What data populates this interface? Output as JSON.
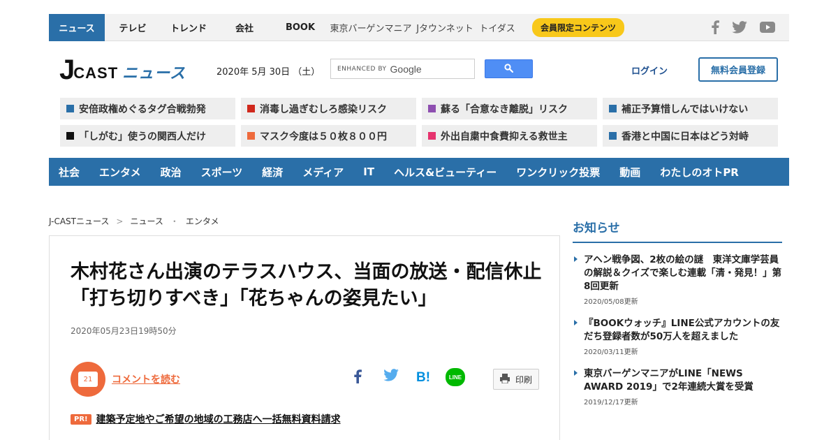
{
  "topnav": {
    "items": [
      {
        "label": "ニュース",
        "active": true
      },
      {
        "label": "テレビ"
      },
      {
        "label": "トレンド"
      },
      {
        "label": "会社"
      },
      {
        "label": "BOOK"
      },
      {
        "label": "東京バーゲンマニア"
      },
      {
        "label": "Jタウンネット"
      },
      {
        "label": "トイダス"
      }
    ],
    "member_label": "会員限定コンテンツ",
    "social": [
      "facebook-icon",
      "twitter-icon",
      "youtube-icon"
    ]
  },
  "header": {
    "logo_j": "J",
    "logo_cast": "CAST",
    "logo_news": "ニュース",
    "date": "2020年 5月 30日 （土）",
    "search_enhanced": "ENHANCED BY",
    "search_google": "Google",
    "login_label": "ログイン",
    "register_label": "無料会員登録"
  },
  "tags": [
    {
      "label": "安倍政権めぐるタグ合戦勃発",
      "color": "#2a6fa8"
    },
    {
      "label": "消毒し過ぎむしろ感染リスク",
      "color": "#d0281c"
    },
    {
      "label": "蘇る「合意なき離脱」リスク",
      "color": "#8e4fb0"
    },
    {
      "label": "補正予算惜しんではいけない",
      "color": "#2a6fa8"
    },
    {
      "label": "「しがむ」使うの関西人だけ",
      "color": "#111111"
    },
    {
      "label": "マスク今度は５０枚８００円",
      "color": "#ee6a3c"
    },
    {
      "label": "外出自粛中食費抑える救世主",
      "color": "#e6336e"
    },
    {
      "label": "香港と中国に日本はどう対峙",
      "color": "#2a6fa8"
    }
  ],
  "categories": [
    "社会",
    "エンタメ",
    "政治",
    "スポーツ",
    "経済",
    "メディア",
    "IT",
    "ヘルス&ビューティー",
    "ワンクリック投票",
    "動画",
    "わたしのオトPR"
  ],
  "breadcrumb": {
    "items": [
      "J-CASTニュース",
      "ニュース",
      "エンタメ"
    ],
    "sep1": ">",
    "sep2": "・"
  },
  "article": {
    "headline": "木村花さん出演のテラスハウス、当面の放送・配信休止　「打ち切りすべき」「花ちゃんの姿見たい」",
    "published": "2020年05月23日19時50分",
    "comment_count": "21",
    "comment_label": "コメントを読む",
    "print_label": "印刷",
    "hatena_label": "B!",
    "line_label": "LINE",
    "pr_badge": "PR!",
    "pr_link": "建築予定地やご希望の地域の工務店へ一括無料資料請求"
  },
  "notice": {
    "heading": "お知らせ",
    "items": [
      {
        "title": "アヘン戦争図、2枚の絵の謎　東洋文庫学芸員の解説＆クイズで楽しむ連載「清・発見！」第8回更新",
        "date": "2020/05/08更新"
      },
      {
        "title": "『BOOKウォッチ』LINE公式アカウントの友だち登録者数が50万人を超えました",
        "date": "2020/03/11更新"
      },
      {
        "title": "東京バーゲンマニアがLINE「NEWS AWARD 2019」で2年連続大賞を受賞",
        "date": "2019/12/17更新"
      }
    ]
  }
}
